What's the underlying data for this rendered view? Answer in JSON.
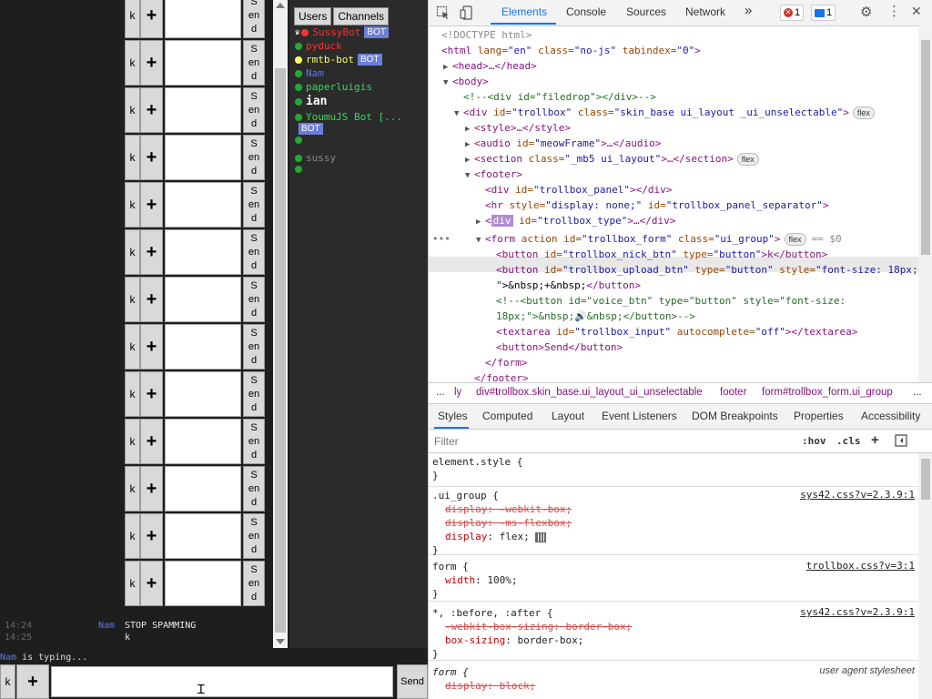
{
  "trollbox": {
    "form_rows": [
      {
        "k": "k",
        "plus": "+",
        "send": [
          "S",
          "en",
          "d"
        ]
      },
      {
        "k": "k",
        "plus": "+",
        "send": [
          "S",
          "en",
          "d"
        ]
      },
      {
        "k": "k",
        "plus": "+",
        "send": [
          "S",
          "en",
          "d"
        ]
      },
      {
        "k": "k",
        "plus": "+",
        "send": [
          "S",
          "en",
          "d"
        ]
      },
      {
        "k": "k",
        "plus": "+",
        "send": [
          "S",
          "en",
          "d"
        ]
      },
      {
        "k": "k",
        "plus": "+",
        "send": [
          "S",
          "en",
          "d"
        ]
      },
      {
        "k": "k",
        "plus": "+",
        "send": [
          "S",
          "en",
          "d"
        ]
      },
      {
        "k": "k",
        "plus": "+",
        "send": [
          "S",
          "en",
          "d"
        ]
      },
      {
        "k": "k",
        "plus": "+",
        "send": [
          "S",
          "en",
          "d"
        ]
      },
      {
        "k": "k",
        "plus": "+",
        "send": [
          "S",
          "en",
          "d"
        ]
      },
      {
        "k": "k",
        "plus": "+",
        "send": [
          "S",
          "en",
          "d"
        ]
      },
      {
        "k": "k",
        "plus": "+",
        "send": [
          "S",
          "en",
          "d"
        ]
      },
      {
        "k": "k",
        "plus": "+",
        "send": [
          "S",
          "en",
          "d"
        ]
      }
    ],
    "messages": [
      {
        "time": "14:24",
        "nick": "Nam",
        "text": "STOP SPAMMING"
      },
      {
        "time": "14:25",
        "nick": "",
        "text": "k"
      }
    ],
    "panel_tabs": [
      "Users",
      "Channels"
    ],
    "users": [
      {
        "name": "SussyBot",
        "color": "#ff3030",
        "dot": "#ff3030",
        "crown": true,
        "bot": "BOT"
      },
      {
        "name": "pyduck",
        "color": "#ff3030",
        "dot": "#22aa33",
        "bot": ""
      },
      {
        "name": "rmtb-bot",
        "color": "#ffff66",
        "dot": "#ffff66",
        "bot": "BOT"
      },
      {
        "name": "Nam",
        "color": "#5b78e6",
        "dot": "#22aa33",
        "bot": ""
      },
      {
        "name": "paperluigis",
        "color": "#33dd55",
        "dot": "#22aa33",
        "bot": ""
      },
      {
        "name": "ian",
        "color": "#ffffff",
        "dot": "#22aa33",
        "bot": ""
      },
      {
        "name": "YoumuJS Bot [...",
        "color": "#33dd55",
        "dot": "#22aa33",
        "bot": "BOT"
      },
      {
        "name": "",
        "color": "#5b78e6",
        "dot": "#22aa33",
        "bot": ""
      },
      {
        "name": "sussy",
        "color": "#888888",
        "dot": "#22aa33",
        "bot": ""
      },
      {
        "name": "",
        "color": "#5b78e6",
        "dot": "#22aa33",
        "bot": ""
      }
    ],
    "typing": {
      "nick": "Nam",
      "text": "is typing..."
    },
    "bottom_form": {
      "k": "k",
      "plus": "+",
      "send": "Send"
    }
  },
  "devtools": {
    "tabs": [
      "Elements",
      "Console",
      "Sources",
      "Network"
    ],
    "more": "»",
    "errors": "1",
    "messages": "1",
    "breadcrumbs": [
      "...",
      "ly",
      "div#trollbox.skin_base.ui_layout_ui_unselectable",
      "footer",
      "form#trollbox_form.ui_group",
      "..."
    ],
    "sub_tabs": [
      "Styles",
      "Computed",
      "Layout",
      "Event Listeners",
      "DOM Breakpoints",
      "Properties",
      "Accessibility"
    ],
    "filter_placeholder": "Filter",
    "hov": ":hov",
    "cls": ".cls",
    "plus": "+",
    "selected_marker": "== $0",
    "dom": {
      "l0": "<!DOCTYPE html>",
      "l1_tag": "<html",
      "l1_a1": " lang=",
      "l1_v1": "\"en\"",
      "l1_a2": " class=",
      "l1_v2": "\"no-js\"",
      "l1_a3": " tabindex=",
      "l1_v3": "\"0\"",
      "l1_end": ">",
      "l2": "<head>…</head>",
      "l3": "<body>",
      "l4": "<!--<div id=\"filedrop\"></div>-->",
      "l5_tag": "<div",
      "l5_a1": " id=",
      "l5_v1": "\"trollbox\"",
      "l5_a2": " class=",
      "l5_v2": "\"skin_base ui_layout _ui_unselectable\"",
      "l5_end": ">",
      "l6": "<style>…</style>",
      "l7_tag": "<audio",
      "l7_a1": " id=",
      "l7_v1": "\"meowFrame\"",
      "l7_end": ">…</audio>",
      "l8_tag": "<section",
      "l8_a1": " class=",
      "l8_v1": "\"_mb5 ui_layout\"",
      "l8_end": ">…</section>",
      "l9": "<footer>",
      "l10_tag": "<div",
      "l10_a1": " id=",
      "l10_v1": "\"trollbox_panel\"",
      "l10_end": "></div>",
      "l11_tag": "<hr",
      "l11_a1": " style=",
      "l11_v1": "\"display: none;\"",
      "l11_a2": " id=",
      "l11_v2": "\"trollbox_panel_separator\"",
      "l11_end": ">",
      "l12_div": "div",
      "l12_a1": " id=",
      "l12_v1": "\"trollbox_type\"",
      "l12_end": ">…</div>",
      "l13_tag": "<form",
      "l13_a1": " action",
      "l13_a2": " id=",
      "l13_v2": "\"trollbox_form\"",
      "l13_a3": " class=",
      "l13_v3": "\"ui_group\"",
      "l13_end": ">",
      "l14_tag": "<button",
      "l14_a1": " id=",
      "l14_v1": "\"trollbox_nick_btn\"",
      "l14_a2": " type=",
      "l14_v2": "\"button\"",
      "l14_end": ">k</button>",
      "l15_tag": "<button",
      "l15_a1": " id=",
      "l15_v1": "\"trollbox_upload_btn\"",
      "l15_a2": " type=",
      "l15_v2": "\"button\"",
      "l15_a3": " style=",
      "l15_v3": "\"font-size: 18px;",
      "l16_v": "\"",
      "l16_txt": ">&nbsp;+&nbsp;",
      "l16_end": "</button>",
      "l17": "<!--<button id=\"voice_btn\" type=\"button\" style=\"font-size:",
      "l18": "18px;\">&nbsp;🔊&nbsp;</button>-->",
      "l19_tag": "<textarea",
      "l19_a1": " id=",
      "l19_v1": "\"trollbox_input\"",
      "l19_a2": " autocomplete=",
      "l19_v2": "\"off\"",
      "l19_end": "></textarea>",
      "l20": "<button>Send</button>",
      "l21": "</form>",
      "l22": "</footer>",
      "flex": "flex"
    },
    "styles": {
      "r0_sel": "element.style {",
      "r0_close": "}",
      "r1_sel": ".ui_group {",
      "r1_src": "sys42.css?v=2.3.9:1",
      "r1_p1": "display: -webkit-box;",
      "r1_p2": "display: -ms-flexbox;",
      "r1_p3n": "display",
      "r1_p3v": "flex;",
      "r1_close": "}",
      "r2_sel": "form {",
      "r2_src": "trollbox.css?v=3:1",
      "r2_pn": "width",
      "r2_pv": "100%;",
      "r2_close": "}",
      "r3_sel": "*, :before, :after {",
      "r3_src": "sys42.css?v=2.3.9:1",
      "r3_p1": "-webkit-box-sizing: border-box;",
      "r3_p2n": "box-sizing",
      "r3_p2v": "border-box;",
      "r3_close": "}",
      "r4_sel": "form {",
      "r4_src": "user agent stylesheet",
      "r4_p1": "display: block;"
    }
  }
}
